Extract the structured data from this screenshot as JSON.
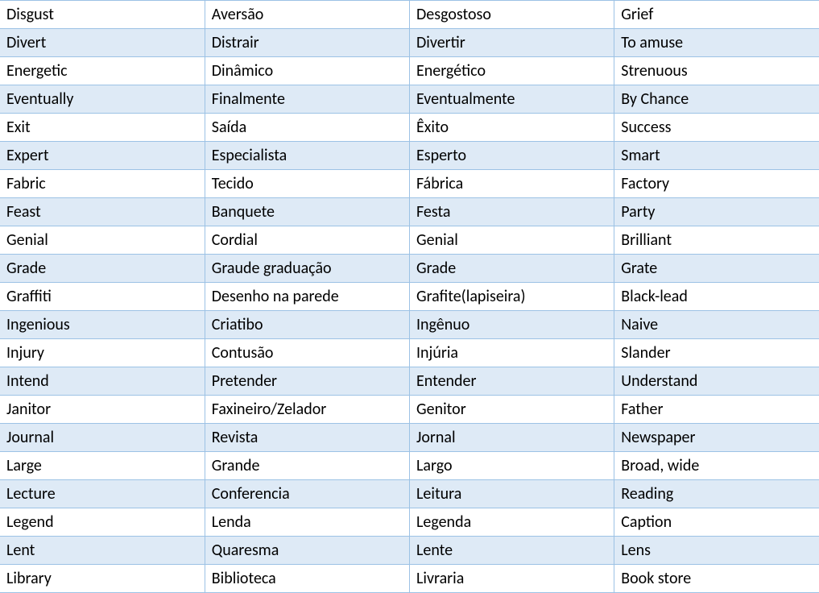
{
  "table": {
    "rows": [
      {
        "cells": [
          "Disgust",
          "Aversão",
          "Desgostoso",
          "Grief"
        ]
      },
      {
        "cells": [
          "Divert",
          "Distrair",
          "Divertir",
          "To amuse"
        ]
      },
      {
        "cells": [
          "Energetic",
          "Dinâmico",
          "Energético",
          "Strenuous"
        ]
      },
      {
        "cells": [
          "Eventually",
          "Finalmente",
          "Eventualmente",
          "By Chance"
        ]
      },
      {
        "cells": [
          "Exit",
          "Saída",
          "Êxito",
          "Success"
        ]
      },
      {
        "cells": [
          "Expert",
          "Especialista",
          "Esperto",
          "Smart"
        ]
      },
      {
        "cells": [
          "Fabric",
          "Tecido",
          "Fábrica",
          "Factory"
        ]
      },
      {
        "cells": [
          "Feast",
          "Banquete",
          "Festa",
          "Party"
        ]
      },
      {
        "cells": [
          "Genial",
          "Cordial",
          "Genial",
          "Brilliant"
        ]
      },
      {
        "cells": [
          "Grade",
          "Graude graduação",
          "Grade",
          "Grate"
        ]
      },
      {
        "cells": [
          "Graffiti",
          "Desenho na parede",
          "Grafite(lapiseira)",
          "Black-lead"
        ]
      },
      {
        "cells": [
          "Ingenious",
          "Criatibo",
          "Ingênuo",
          "Naive"
        ]
      },
      {
        "cells": [
          "Injury",
          "Contusão",
          "Injúria",
          "Slander"
        ]
      },
      {
        "cells": [
          "Intend",
          "Pretender",
          "Entender",
          "Understand"
        ]
      },
      {
        "cells": [
          "Janitor",
          "Faxineiro/Zelador",
          "Genitor",
          "Father"
        ]
      },
      {
        "cells": [
          "Journal",
          "Revista",
          "Jornal",
          "Newspaper"
        ]
      },
      {
        "cells": [
          "Large",
          "Grande",
          "Largo",
          "Broad, wide"
        ]
      },
      {
        "cells": [
          "Lecture",
          "Conferencia",
          "Leitura",
          "Reading"
        ]
      },
      {
        "cells": [
          "Legend",
          "Lenda",
          "Legenda",
          "Caption"
        ]
      },
      {
        "cells": [
          "Lent",
          "Quaresma",
          "Lente",
          "Lens"
        ]
      },
      {
        "cells": [
          "Library",
          "Biblioteca",
          "Livraria",
          "Book store"
        ]
      }
    ]
  }
}
